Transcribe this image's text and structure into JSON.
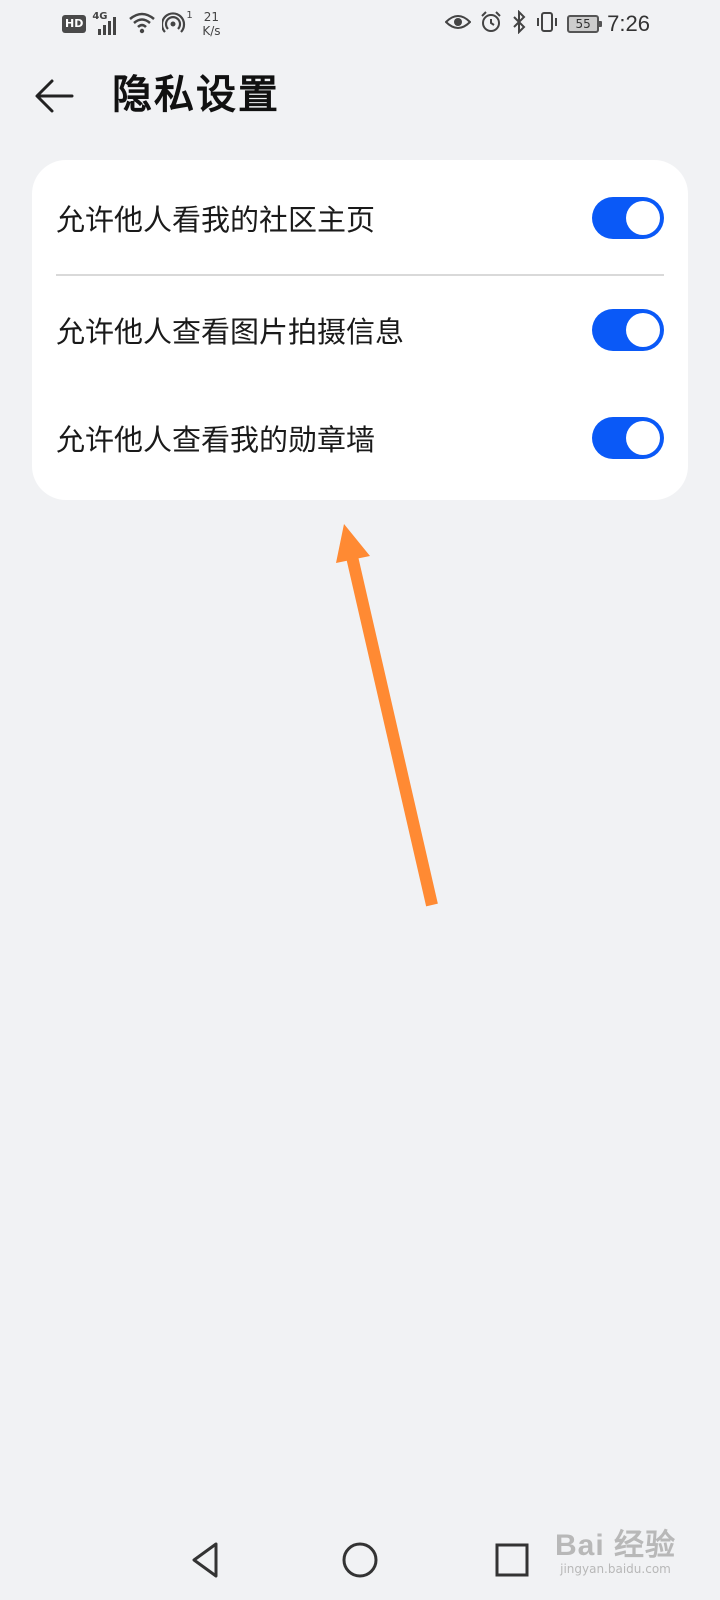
{
  "status_bar": {
    "hd_badge": "HD",
    "network": "4G",
    "hotspot_count": "1",
    "speed_value": "21",
    "speed_unit": "K/s",
    "battery_level": "55",
    "time": "7:26",
    "icons": [
      "hd-icon",
      "signal-4g-icon",
      "wifi-icon",
      "hotspot-icon",
      "eye-comfort-icon",
      "alarm-icon",
      "bluetooth-icon",
      "vibrate-icon",
      "battery-icon"
    ]
  },
  "header": {
    "back_icon": "arrow-left-icon",
    "title": "隐私设置"
  },
  "settings": {
    "items": [
      {
        "label": "允许他人看我的社区主页",
        "enabled": true
      },
      {
        "label": "允许他人查看图片拍摄信息",
        "enabled": true
      },
      {
        "label": "允许他人查看我的勋章墙",
        "enabled": true
      }
    ]
  },
  "annotation": {
    "type": "arrow",
    "color": "#ff8a33"
  },
  "nav_bar": {
    "buttons": [
      "back-triangle-icon",
      "home-circle-icon",
      "recents-square-icon"
    ]
  },
  "watermark": {
    "logo_text": "Bai 经验",
    "url": "jingyan.baidu.com"
  },
  "colors": {
    "accent": "#0a59f7",
    "background": "#f1f2f4",
    "card": "#ffffff"
  }
}
